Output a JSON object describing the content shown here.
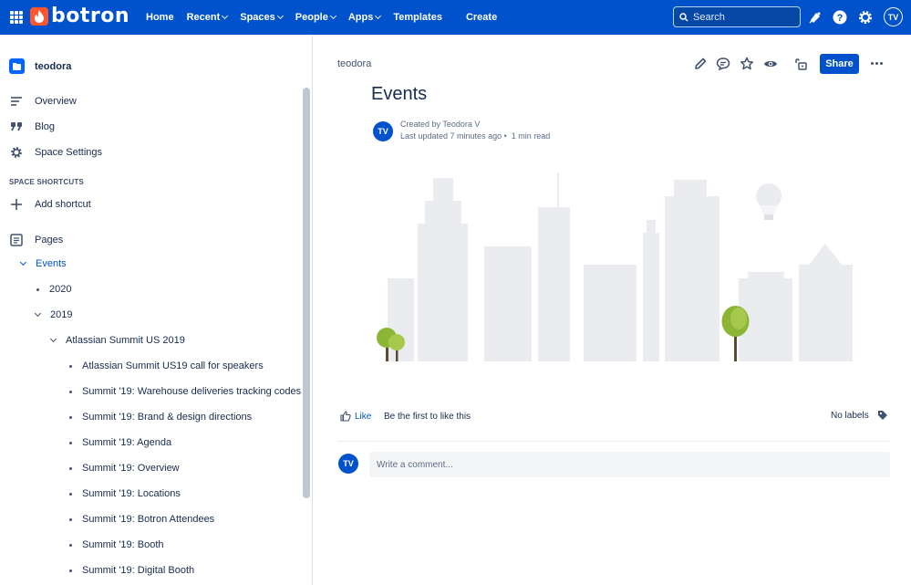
{
  "topbar": {
    "logo_text": "botron",
    "nav": [
      {
        "label": "Home",
        "has_menu": false
      },
      {
        "label": "Recent",
        "has_menu": true
      },
      {
        "label": "Spaces",
        "has_menu": true
      },
      {
        "label": "People",
        "has_menu": true
      },
      {
        "label": "Apps",
        "has_menu": true
      },
      {
        "label": "Templates",
        "has_menu": false
      }
    ],
    "create_label": "Create",
    "search_placeholder": "Search",
    "avatar_initials": "TV"
  },
  "sidebar": {
    "space_name": "teodora",
    "items": [
      {
        "label": "Overview",
        "icon": "overview-icon"
      },
      {
        "label": "Blog",
        "icon": "quote-icon"
      },
      {
        "label": "Space Settings",
        "icon": "gear-icon"
      }
    ],
    "shortcuts_title": "SPACE SHORTCUTS",
    "add_shortcut": "Add shortcut",
    "pages_label": "Pages",
    "tree": [
      {
        "label": "Events",
        "type": "expanded",
        "active": true
      },
      {
        "label": "2020",
        "type": "bullet"
      },
      {
        "label": "2019",
        "type": "expanded"
      },
      {
        "label": "Atlassian Summit US 2019",
        "type": "expanded"
      },
      {
        "label": "Atlassian Summit US19 call for speakers",
        "type": "bullet"
      },
      {
        "label": "Summit '19: Warehouse deliveries tracking codes",
        "type": "bullet"
      },
      {
        "label": "Summit '19: Brand & design directions",
        "type": "bullet"
      },
      {
        "label": "Summit '19: Agenda",
        "type": "bullet"
      },
      {
        "label": "Summit '19: Overview",
        "type": "bullet"
      },
      {
        "label": "Summit '19: Locations",
        "type": "bullet"
      },
      {
        "label": "Summit '19: Botron Attendees",
        "type": "bullet"
      },
      {
        "label": "Summit '19: Booth",
        "type": "bullet"
      },
      {
        "label": "Summit '19: Digital Booth",
        "type": "bullet"
      }
    ]
  },
  "main": {
    "breadcrumb": "teodora",
    "title": "Events",
    "share_label": "Share",
    "author_initials": "TV",
    "created_by": "Created by Teodora V",
    "last_updated": "Last updated 7 minutes ago",
    "read_time": "1 min read",
    "like_label": "Like",
    "like_prompt": "Be the first to like this",
    "labels_text": "No labels",
    "comment_placeholder": "Write a comment...",
    "commenter_initials": "TV"
  },
  "colors": {
    "topbar": "#0052CC",
    "accent": "#0052CC",
    "logo": "#FF5630"
  }
}
